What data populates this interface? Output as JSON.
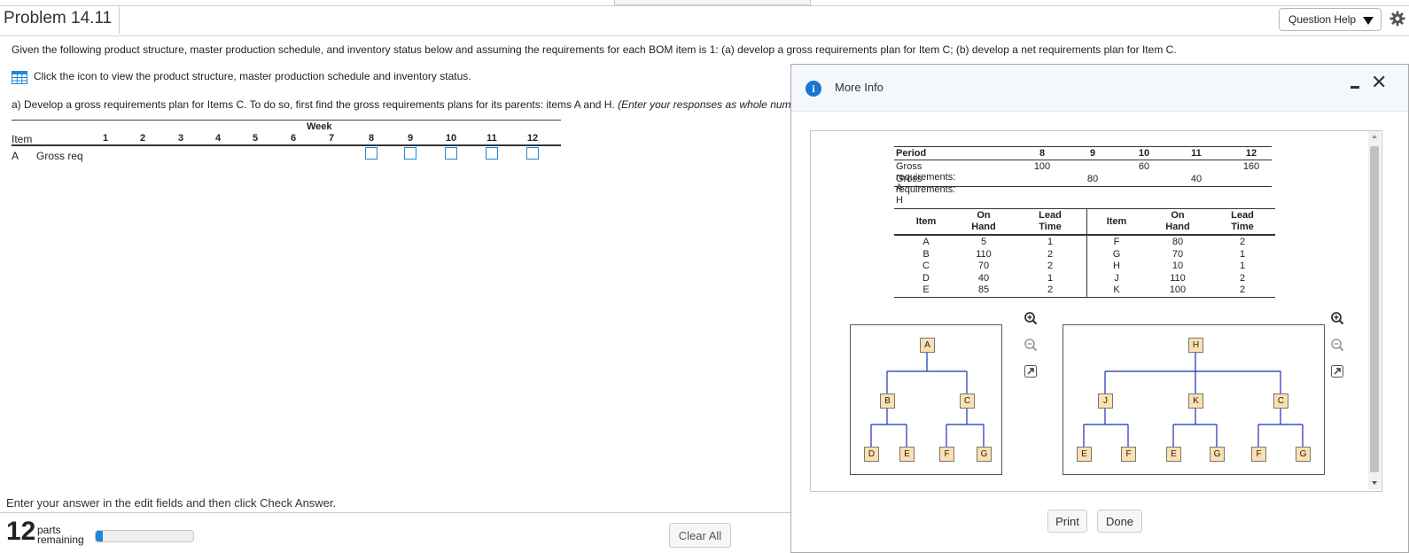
{
  "header": {
    "title": "Problem 14.11",
    "question_help": "Question Help"
  },
  "problem": {
    "statement": "Given the following product structure, master production schedule, and inventory status below and assuming the requirements for each BOM item is 1: (a) develop a gross requirements plan for Item C; (b) develop a net requirements plan for Item C.",
    "click_text": "Click the icon to view the product structure, master production schedule and inventory status.",
    "part_a": "a) Develop a gross requirements plan for Items C. To do so, first find the gross requirements plans for its parents: items A and H.",
    "part_a_hint": "(Enter your responses as whole numbers)."
  },
  "worksheet": {
    "week_label": "Week",
    "item_header": "Item",
    "periods": [
      "1",
      "2",
      "3",
      "4",
      "5",
      "6",
      "7",
      "8",
      "9",
      "10",
      "11",
      "12"
    ],
    "row_item": "A",
    "row_label": "Gross req",
    "inputs": [
      {
        "period": "8",
        "value": ""
      },
      {
        "period": "9",
        "value": ""
      },
      {
        "period": "10",
        "value": ""
      },
      {
        "period": "11",
        "value": ""
      },
      {
        "period": "12",
        "value": ""
      }
    ]
  },
  "footer": {
    "instructions": "Enter your answer in the edit fields and then click Check Answer.",
    "parts_count": "12",
    "parts_label_1": "parts",
    "parts_label_2": "remaining",
    "progress_fraction": 0.07,
    "clear_all": "Clear All"
  },
  "modal": {
    "title": "More Info",
    "mps": {
      "period_header": "Period",
      "periods": [
        "8",
        "9",
        "10",
        "11",
        "12"
      ],
      "rows": [
        {
          "label": "Gross requirements: A",
          "values": [
            "100",
            "",
            "60",
            "",
            "160"
          ]
        },
        {
          "label": "Gross requirements: H",
          "values": [
            "",
            "80",
            "",
            "40",
            ""
          ]
        }
      ]
    },
    "inventory": {
      "headers": {
        "item": "Item",
        "on_hand_1": "On",
        "on_hand_2": "Hand",
        "lead_1": "Lead",
        "lead_2": "Time"
      },
      "left": {
        "items": [
          "A",
          "B",
          "C",
          "D",
          "E"
        ],
        "on_hand": [
          "5",
          "110",
          "70",
          "40",
          "85"
        ],
        "lead_time": [
          "1",
          "2",
          "2",
          "1",
          "2"
        ]
      },
      "right": {
        "items": [
          "F",
          "G",
          "H",
          "J",
          "K"
        ],
        "on_hand": [
          "80",
          "70",
          "10",
          "110",
          "100"
        ],
        "lead_time": [
          "2",
          "1",
          "1",
          "2",
          "2"
        ]
      }
    },
    "tree_a": {
      "root": "A",
      "level1": [
        "B",
        "C"
      ],
      "level2": [
        "D",
        "E",
        "F",
        "G"
      ]
    },
    "tree_h": {
      "root": "H",
      "level1": [
        "J",
        "K",
        "C"
      ],
      "level2": [
        "E",
        "F",
        "E",
        "G",
        "F",
        "G"
      ]
    },
    "print": "Print",
    "done": "Done"
  },
  "colors": {
    "accent": "#1e88d8",
    "node_fill": "#fce0b0",
    "tree_line": "#1b2fb8",
    "info_blue": "#1976d2"
  }
}
